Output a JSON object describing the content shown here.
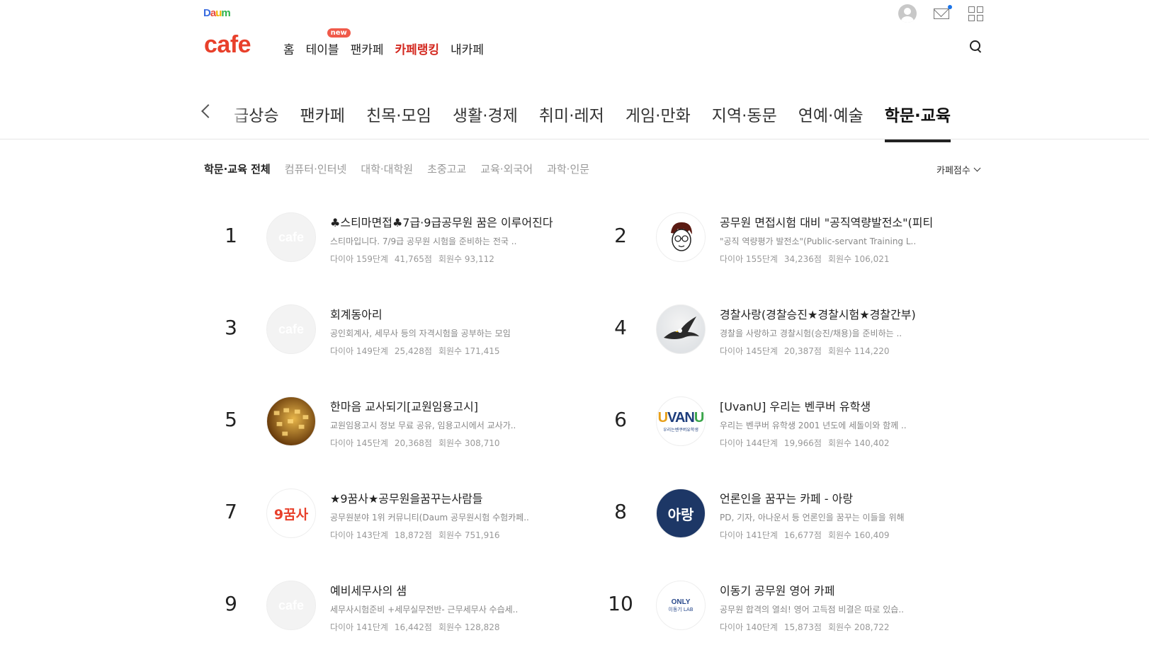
{
  "top": {
    "daum_logo": [
      "D",
      "a",
      "u",
      "m"
    ],
    "icons": [
      "profile-icon",
      "mail-icon",
      "apps-icon"
    ]
  },
  "header": {
    "logo": "cafe",
    "nav": [
      {
        "label": "홈",
        "active": false
      },
      {
        "label": "테이블",
        "active": false,
        "badge": "new"
      },
      {
        "label": "팬카페",
        "active": false
      },
      {
        "label": "카페랭킹",
        "active": true
      },
      {
        "label": "내카페",
        "active": false
      }
    ],
    "search_icon": "search-icon"
  },
  "categories": {
    "items": [
      "급상승",
      "팬카페",
      "친목·모임",
      "생활·경제",
      "취미·레저",
      "게임·만화",
      "지역·동문",
      "연예·예술",
      "학문·교육"
    ],
    "active": "학문·교육"
  },
  "sub_tabs": {
    "items": [
      "학문·교육 전체",
      "컴퓨터·인터넷",
      "대학·대학원",
      "초중고교",
      "교육·외국어",
      "과학·인문"
    ],
    "active": "학문·교육 전체"
  },
  "sort": {
    "label": "카페점수"
  },
  "ranking": [
    {
      "rank": "1",
      "title": "♣스티마면접♣7급·9급공무원 꿈은 이루어진다",
      "desc": "스티마입니다. 7/9급 공무원 시험을 준비하는 전국 ..",
      "level": "다이아 159단계",
      "score": "41,765점",
      "members": "회원수 93,112",
      "thumb": "default"
    },
    {
      "rank": "2",
      "title": "공무원 면접시험 대비 \"공직역량발전소\"(피티",
      "desc": "\"공직 역량평가 발전소\"(Public-servant Training L..",
      "level": "다이아 155단계",
      "score": "34,236점",
      "members": "회원수 106,021",
      "thumb": "face"
    },
    {
      "rank": "3",
      "title": "회계동아리",
      "desc": "공인회계사, 세무사 등의 자격시험을 공부하는 모임",
      "level": "다이아 149단계",
      "score": "25,428점",
      "members": "회원수 171,415",
      "thumb": "default"
    },
    {
      "rank": "4",
      "title": "경찰사랑(경찰승진★경찰시험★경찰간부)",
      "desc": "경찰을 사랑하고 경찰시험(승진/채용)을 준비하는 ..",
      "level": "다이아 145단계",
      "score": "20,387점",
      "members": "회원수 114,220",
      "thumb": "eagle"
    },
    {
      "rank": "5",
      "title": "한마음 교사되기[교원임용고시]",
      "desc": "교원임용고시 정보 무료 공유, 임용고시에서 교사가..",
      "level": "다이아 145단계",
      "score": "20,368점",
      "members": "회원수 308,710",
      "thumb": "gold"
    },
    {
      "rank": "6",
      "title": "[UvanU] 우리는 벤쿠버 유학생",
      "desc": "우리는 벤쿠버 유학생 2001 년도에 세돌이와 함께 ..",
      "level": "다이아 144단계",
      "score": "19,966점",
      "members": "회원수 140,402",
      "thumb": "uvan"
    },
    {
      "rank": "7",
      "title": "★9꿈사★공무원을꿈꾸는사람들",
      "desc": "공무원분야 1위 커뮤니티(Daum 공무원시험 수험카페..",
      "level": "다이아 143단계",
      "score": "18,872점",
      "members": "회원수 751,916",
      "thumb": "qkm"
    },
    {
      "rank": "8",
      "title": "언론인을 꿈꾸는 카페 - 아랑",
      "desc": "PD, 기자, 아나운서 등 언론인을 꿈꾸는 이들을 위해",
      "level": "다이아 141단계",
      "score": "16,677점",
      "members": "회원수 160,409",
      "thumb": "arang"
    },
    {
      "rank": "9",
      "title": "예비세무사의 샘",
      "desc": "세무사시험준비 +세무실무전반- 근무세무사 수습세..",
      "level": "다이아 141단계",
      "score": "16,442점",
      "members": "회원수 128,828",
      "thumb": "default"
    },
    {
      "rank": "10",
      "title": "이동기 공무원 영어 카페",
      "desc": "공무원 합격의 열쇠! 영어 고득점 비결은 따로 있습..",
      "level": "다이아 140단계",
      "score": "15,873점",
      "members": "회원수 208,722",
      "thumb": "lab"
    }
  ],
  "thumb_text": {
    "default": "cafe",
    "uvan": "UVANU",
    "uvan_sub": "우리는벤쿠버유학생",
    "qkm": "9꿈사",
    "arang": "아랑",
    "lab": "ONLY",
    "lab_sub": "이동기 LAB"
  }
}
